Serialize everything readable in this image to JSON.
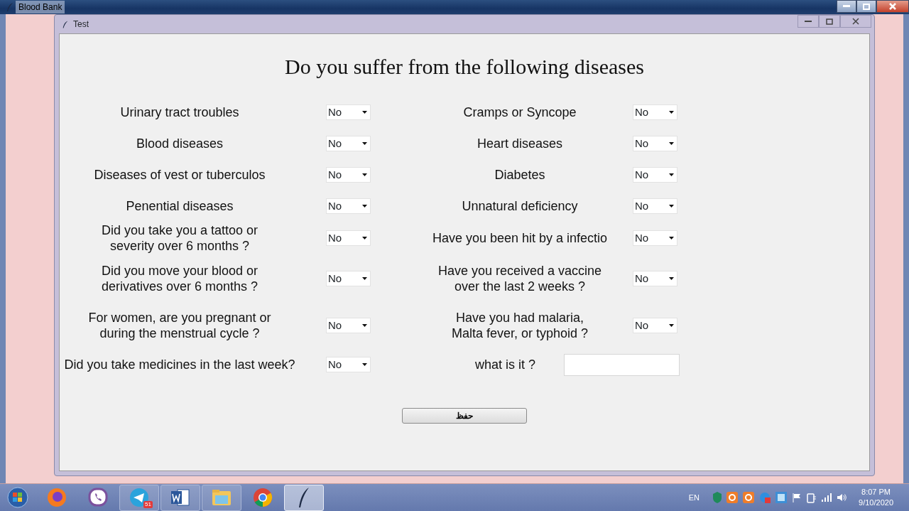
{
  "outer_window": {
    "title": "Blood Bank"
  },
  "dialog": {
    "title": "Test",
    "heading": "Do you suffer from the following diseases",
    "rows": [
      {
        "left": {
          "label": "Urinary tract troubles",
          "value": "No"
        },
        "right": {
          "kind": "select",
          "label": "Cramps or Syncope",
          "value": "No"
        }
      },
      {
        "left": {
          "label": "Blood diseases",
          "value": "No"
        },
        "right": {
          "kind": "select",
          "label": "Heart diseases",
          "value": "No"
        }
      },
      {
        "left": {
          "label": "Diseases of vest or tuberculos",
          "value": "No"
        },
        "right": {
          "kind": "select",
          "label": "Diabetes",
          "value": "No"
        }
      },
      {
        "left": {
          "label": "Penential diseases",
          "value": "No"
        },
        "right": {
          "kind": "select",
          "label": "Unnatural deficiency",
          "value": "No"
        }
      },
      {
        "left": {
          "label": "Did you take you a tattoo or\n severity over 6 months ?",
          "value": "No"
        },
        "right": {
          "kind": "select",
          "label": "Have you been hit by a infectio",
          "value": "No"
        }
      },
      {
        "left": {
          "label": "Did you move your blood or\n derivatives over 6 months ?",
          "value": "No"
        },
        "right": {
          "kind": "select",
          "label": "Have you received a vaccine\n over the last 2 weeks ?",
          "value": "No"
        }
      },
      {
        "left": {
          "label": "For women, are you pregnant or\n during the menstrual cycle ?",
          "value": "No"
        },
        "right": {
          "kind": "select",
          "label": "Have you had malaria,\n   Malta fever, or typhoid ?",
          "value": "No"
        }
      },
      {
        "left": {
          "label": "Did you take medicines in the last week?",
          "value": "No"
        },
        "right": {
          "kind": "text",
          "label": "what is it ?"
        }
      }
    ],
    "save_button": "حفظ"
  },
  "taskbar": {
    "apps": [
      {
        "kind": "start",
        "open": false,
        "active": false
      },
      {
        "kind": "firefox",
        "open": false,
        "active": false
      },
      {
        "kind": "viber",
        "open": false,
        "active": false
      },
      {
        "kind": "telegram",
        "open": true,
        "active": false,
        "badge": "51"
      },
      {
        "kind": "word",
        "open": true,
        "active": false
      },
      {
        "kind": "explorer",
        "open": true,
        "active": false
      },
      {
        "kind": "chrome",
        "open": false,
        "active": false
      },
      {
        "kind": "feather",
        "open": true,
        "active": true
      }
    ],
    "tray": {
      "language": "EN",
      "time": "8:07 PM",
      "date": "9/10/2020"
    }
  }
}
